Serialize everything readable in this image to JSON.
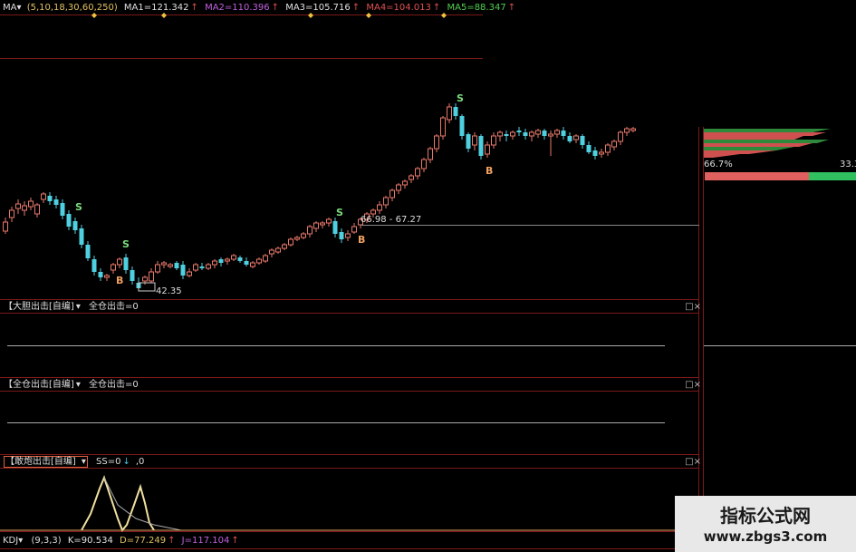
{
  "ma_bar": {
    "name": "MA",
    "params": "(5,10,18,30,60,250)",
    "ma1": "MA1=121.342",
    "ma2": "MA2=110.396",
    "ma3": "MA3=105.716",
    "ma4": "MA4=104.013",
    "ma5": "MA5=88.347",
    "arrow": "↑"
  },
  "colors": {
    "up": "#e8796a",
    "down": "#4fd0e0",
    "bg": "#000000",
    "grid": "#7a1a1a",
    "signal_s": "#7ddc7d",
    "signal_b": "#f0a060",
    "ma1": "#e0e0e0",
    "ma2": "#c060e0",
    "ma3": "#e0e0e0",
    "ma4": "#e05050",
    "ma5": "#50d050"
  },
  "main_chart": {
    "low_label": "42.35",
    "range_label": "66.98 - 67.27",
    "signal_s": "S",
    "signal_b": "B"
  },
  "side_panel": {
    "pct_left": "66.7%",
    "pct_right": "33.3"
  },
  "panel1": {
    "title": "【大胆出击[自编]",
    "value": "全仓出击=0"
  },
  "panel2": {
    "title": "【全仓出击[自编]",
    "value": "全仓出击=0"
  },
  "panel3": {
    "title": "【敢炮出击[自编]",
    "value": "SS=0",
    "extra": ",0"
  },
  "kdj_bar": {
    "name": "KDJ",
    "params": "(9,3,3)",
    "k": "K=90.534",
    "d": "D=77.249",
    "j": "J=117.104",
    "arrow": "↑"
  },
  "watermark": {
    "title": "指标公式网",
    "url": "www.zbgs3.com"
  },
  "buttons": {
    "restore": "□",
    "close": "×"
  }
}
